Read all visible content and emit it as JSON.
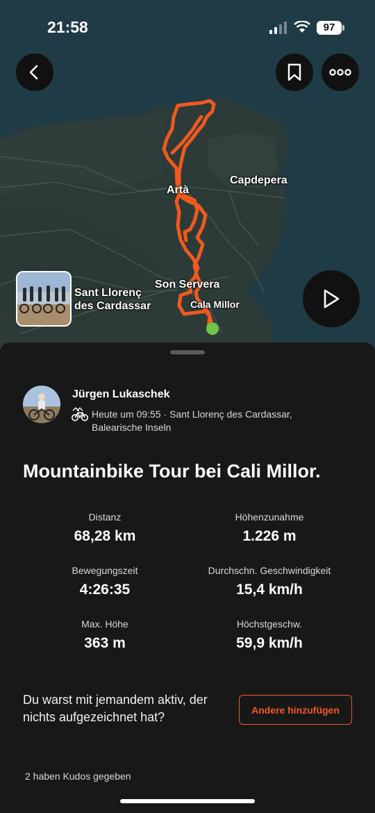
{
  "status_bar": {
    "time": "21:58",
    "battery": "97"
  },
  "map": {
    "labels": {
      "arta": "Artà",
      "capdepera": "Capdepera",
      "son_servera": "Son Servera",
      "cala_millor": "Cala Millor",
      "sant_llorenc": "Sant Llorenç\ndes Cardassar"
    },
    "route_color": "#f0591f",
    "end_marker_color": "#6cc644"
  },
  "athlete": {
    "name": "Jürgen Lukaschek",
    "meta": "Heute um 09:55 · Sant Llorenç des Cardassar, Balearische Inseln",
    "sport_icon": "mountain-bike-icon"
  },
  "activity": {
    "title": "Mountainbike Tour bei  Cali Millor."
  },
  "stats": [
    {
      "label": "Distanz",
      "value": "68,28 km"
    },
    {
      "label": "Höhenzunahme",
      "value": "1.226 m"
    },
    {
      "label": "Bewegungszeit",
      "value": "4:26:35"
    },
    {
      "label": "Durchschn. Geschwindigkeit",
      "value": "15,4 km/h"
    },
    {
      "label": "Max. Höhe",
      "value": "363 m"
    },
    {
      "label": "Höchstgeschw.",
      "value": "59,9 km/h"
    }
  ],
  "partners": {
    "prompt": "Du warst mit jemandem aktiv, der nichts aufgezeichnet hat?",
    "button": "Andere hinzufügen"
  },
  "kudos": "2 haben Kudos gegeben",
  "colors": {
    "accent": "#f05a22",
    "background": "#181818"
  }
}
